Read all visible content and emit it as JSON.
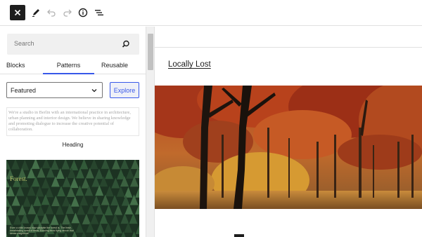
{
  "toolbar": {
    "close": "close-icon",
    "tools": "pencil-icon",
    "undo": "undo-icon",
    "redo": "redo-icon",
    "details": "info-icon",
    "list_view": "list-view-icon"
  },
  "inserter": {
    "search": {
      "placeholder": "Search",
      "icon": "search-icon"
    },
    "tabs": [
      {
        "label": "Blocks",
        "active": false
      },
      {
        "label": "Patterns",
        "active": true
      },
      {
        "label": "Reusable",
        "active": false
      }
    ],
    "category": {
      "selected": "Featured"
    },
    "explore_label": "Explore",
    "patterns": [
      {
        "preview_text": "We're a studio in Berlin with an international practice in architecture, urban planning and interior design. We believe in sharing knowledge and promoting dialogue to increase the creative potential of collaboration.",
        "caption": "Heading"
      },
      {
        "preview_title": "Forest.",
        "preview_caption": "Even a child knows how valuable the forest is. The fresh, breathtaking smell of trees. Echoing birds flying above that dense magnitude."
      }
    ]
  },
  "canvas": {
    "site_title": "Locally Lost"
  },
  "colors": {
    "accent": "#3858e9",
    "dark": "#1e1e1e",
    "border": "#e0e0e0"
  }
}
